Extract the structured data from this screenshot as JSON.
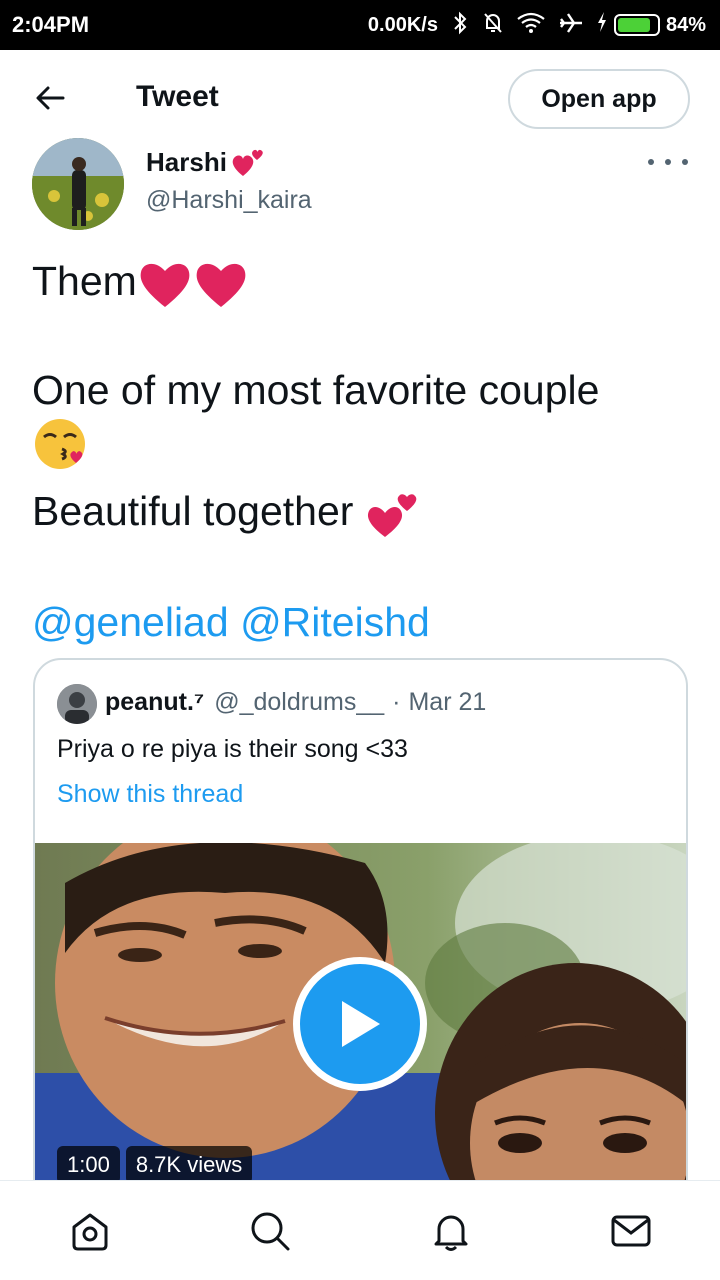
{
  "status_bar": {
    "time": "2:04PM",
    "network_speed": "0.00K/s",
    "battery_percent": "84%",
    "battery_level": 0.84,
    "icons": [
      "bluetooth-icon",
      "mute-icon",
      "wifi-icon",
      "airplane-icon",
      "charging-icon",
      "battery-icon"
    ]
  },
  "header": {
    "back_icon": "back-arrow-icon",
    "title": "Tweet",
    "open_app_label": "Open app"
  },
  "tweet": {
    "author_name": "Harshi",
    "author_handle": "@Harshi_kaira",
    "lines": {
      "line1": "Them",
      "line2": "One of my most favorite couple",
      "line3": "Beautiful together",
      "mention1": "@geneliad",
      "mention2": "@Riteishd"
    }
  },
  "quote": {
    "author_name": "peanut.⁷",
    "author_handle": "@_doldrums__",
    "separator": "·",
    "date": "Mar 21",
    "text": "Priya o re piya is their song <33",
    "show_thread": "Show this thread",
    "media": {
      "duration": "1:00",
      "views": "8.7K views"
    }
  },
  "bottom_nav": {
    "items": [
      "home-icon",
      "search-icon",
      "notifications-icon",
      "messages-icon"
    ]
  },
  "colors": {
    "accent": "#1d9bf0",
    "text": "#0f1419",
    "secondary": "#536471",
    "heart": "#e0245e",
    "border": "#cfd9de"
  }
}
